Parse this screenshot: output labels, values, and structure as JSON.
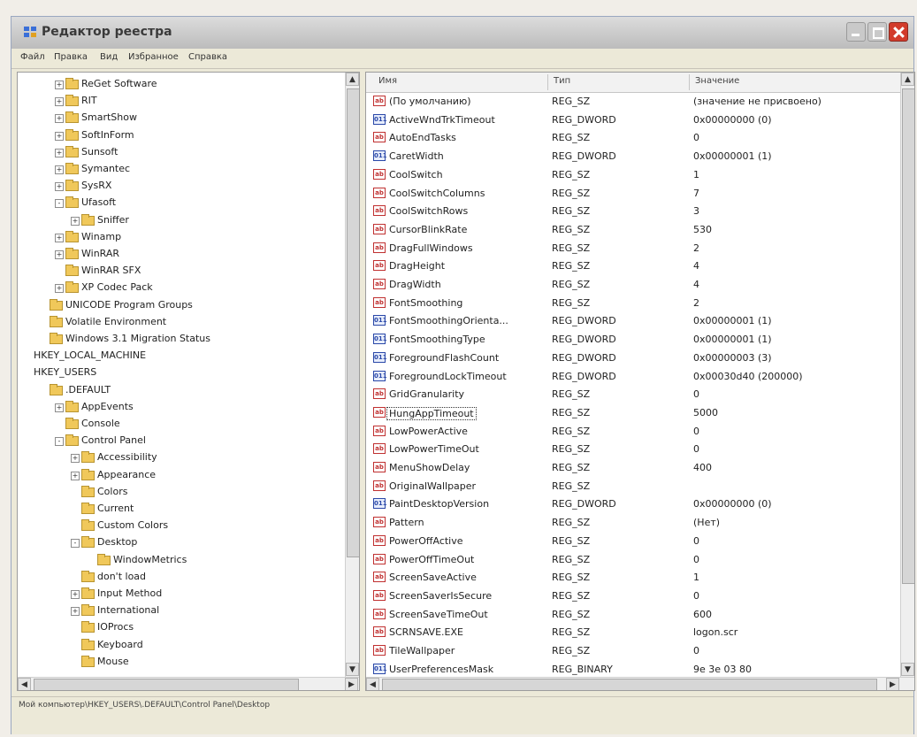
{
  "window": {
    "title": "Редактор реестра"
  },
  "menu": [
    "Файл",
    "Правка",
    "Вид",
    "Избранное",
    "Справка"
  ],
  "tree": [
    {
      "label": "ReGet Software",
      "level": 0,
      "expand": "+"
    },
    {
      "label": "RIT",
      "level": 0,
      "expand": "+"
    },
    {
      "label": "SmartShow",
      "level": 0,
      "expand": "+"
    },
    {
      "label": "SoftInForm",
      "level": 0,
      "expand": "+"
    },
    {
      "label": "Sunsoft",
      "level": 0,
      "expand": "+"
    },
    {
      "label": "Symantec",
      "level": 0,
      "expand": "+"
    },
    {
      "label": "SysRX",
      "level": 0,
      "expand": "+"
    },
    {
      "label": "Ufasoft",
      "level": 0,
      "expand": "-"
    },
    {
      "label": "Sniffer",
      "level": 1,
      "expand": "+"
    },
    {
      "label": "Winamp",
      "level": 0,
      "expand": "+"
    },
    {
      "label": "WinRAR",
      "level": 0,
      "expand": "+"
    },
    {
      "label": "WinRAR SFX",
      "level": 0,
      "expand": ""
    },
    {
      "label": "XP Codec Pack",
      "level": 0,
      "expand": "+"
    },
    {
      "label": "UNICODE Program Groups",
      "level": -1,
      "expand": ""
    },
    {
      "label": "Volatile Environment",
      "level": -1,
      "expand": ""
    },
    {
      "label": "Windows 3.1 Migration Status",
      "level": -1,
      "expand": ""
    },
    {
      "label": "HKEY_LOCAL_MACHINE",
      "level": -2,
      "expand": ""
    },
    {
      "label": "HKEY_USERS",
      "level": -2,
      "expand": ""
    },
    {
      "label": ".DEFAULT",
      "level": -1,
      "expand": ""
    },
    {
      "label": "AppEvents",
      "level": 0,
      "expand": "+"
    },
    {
      "label": "Console",
      "level": 0,
      "expand": ""
    },
    {
      "label": "Control Panel",
      "level": 0,
      "expand": "-"
    },
    {
      "label": "Accessibility",
      "level": 1,
      "expand": "+"
    },
    {
      "label": "Appearance",
      "level": 1,
      "expand": "+"
    },
    {
      "label": "Colors",
      "level": 1,
      "expand": ""
    },
    {
      "label": "Current",
      "level": 1,
      "expand": ""
    },
    {
      "label": "Custom Colors",
      "level": 1,
      "expand": ""
    },
    {
      "label": "Desktop",
      "level": 1,
      "expand": "-"
    },
    {
      "label": "WindowMetrics",
      "level": 2,
      "expand": ""
    },
    {
      "label": "don't load",
      "level": 1,
      "expand": ""
    },
    {
      "label": "Input Method",
      "level": 1,
      "expand": "+"
    },
    {
      "label": "International",
      "level": 1,
      "expand": "+"
    },
    {
      "label": "IOProcs",
      "level": 1,
      "expand": ""
    },
    {
      "label": "Keyboard",
      "level": 1,
      "expand": ""
    },
    {
      "label": "Mouse",
      "level": 1,
      "expand": ""
    }
  ],
  "list": {
    "headers": [
      "Имя",
      "Тип",
      "Значение"
    ],
    "rows": [
      {
        "name": "(По умолчанию)",
        "type": "REG_SZ",
        "value": "(значение не присвоено)",
        "icon": "ab"
      },
      {
        "name": "ActiveWndTrkTimeout",
        "type": "REG_DWORD",
        "value": "0x00000000 (0)",
        "icon": "bin"
      },
      {
        "name": "AutoEndTasks",
        "type": "REG_SZ",
        "value": "0",
        "icon": "ab"
      },
      {
        "name": "CaretWidth",
        "type": "REG_DWORD",
        "value": "0x00000001 (1)",
        "icon": "bin"
      },
      {
        "name": "CoolSwitch",
        "type": "REG_SZ",
        "value": "1",
        "icon": "ab"
      },
      {
        "name": "CoolSwitchColumns",
        "type": "REG_SZ",
        "value": "7",
        "icon": "ab"
      },
      {
        "name": "CoolSwitchRows",
        "type": "REG_SZ",
        "value": "3",
        "icon": "ab"
      },
      {
        "name": "CursorBlinkRate",
        "type": "REG_SZ",
        "value": "530",
        "icon": "ab"
      },
      {
        "name": "DragFullWindows",
        "type": "REG_SZ",
        "value": "2",
        "icon": "ab"
      },
      {
        "name": "DragHeight",
        "type": "REG_SZ",
        "value": "4",
        "icon": "ab"
      },
      {
        "name": "DragWidth",
        "type": "REG_SZ",
        "value": "4",
        "icon": "ab"
      },
      {
        "name": "FontSmoothing",
        "type": "REG_SZ",
        "value": "2",
        "icon": "ab"
      },
      {
        "name": "FontSmoothingOrienta...",
        "type": "REG_DWORD",
        "value": "0x00000001 (1)",
        "icon": "bin"
      },
      {
        "name": "FontSmoothingType",
        "type": "REG_DWORD",
        "value": "0x00000001 (1)",
        "icon": "bin"
      },
      {
        "name": "ForegroundFlashCount",
        "type": "REG_DWORD",
        "value": "0x00000003 (3)",
        "icon": "bin"
      },
      {
        "name": "ForegroundLockTimeout",
        "type": "REG_DWORD",
        "value": "0x00030d40 (200000)",
        "icon": "bin"
      },
      {
        "name": "GridGranularity",
        "type": "REG_SZ",
        "value": "0",
        "icon": "ab"
      },
      {
        "name": "HungAppTimeout",
        "type": "REG_SZ",
        "value": "5000",
        "icon": "ab",
        "selected": true
      },
      {
        "name": "LowPowerActive",
        "type": "REG_SZ",
        "value": "0",
        "icon": "ab"
      },
      {
        "name": "LowPowerTimeOut",
        "type": "REG_SZ",
        "value": "0",
        "icon": "ab"
      },
      {
        "name": "MenuShowDelay",
        "type": "REG_SZ",
        "value": "400",
        "icon": "ab"
      },
      {
        "name": "OriginalWallpaper",
        "type": "REG_SZ",
        "value": "",
        "icon": "ab"
      },
      {
        "name": "PaintDesktopVersion",
        "type": "REG_DWORD",
        "value": "0x00000000 (0)",
        "icon": "bin"
      },
      {
        "name": "Pattern",
        "type": "REG_SZ",
        "value": "(Нет)",
        "icon": "ab"
      },
      {
        "name": "PowerOffActive",
        "type": "REG_SZ",
        "value": "0",
        "icon": "ab"
      },
      {
        "name": "PowerOffTimeOut",
        "type": "REG_SZ",
        "value": "0",
        "icon": "ab"
      },
      {
        "name": "ScreenSaveActive",
        "type": "REG_SZ",
        "value": "1",
        "icon": "ab"
      },
      {
        "name": "ScreenSaverIsSecure",
        "type": "REG_SZ",
        "value": "0",
        "icon": "ab"
      },
      {
        "name": "ScreenSaveTimeOut",
        "type": "REG_SZ",
        "value": "600",
        "icon": "ab"
      },
      {
        "name": "SCRNSAVE.EXE",
        "type": "REG_SZ",
        "value": "logon.scr",
        "icon": "ab"
      },
      {
        "name": "TileWallpaper",
        "type": "REG_SZ",
        "value": "0",
        "icon": "ab"
      },
      {
        "name": "UserPreferencesMask",
        "type": "REG_BINARY",
        "value": "9e 3e 03 80",
        "icon": "bin"
      }
    ]
  },
  "status": "Мой компьютер\\HKEY_USERS\\.DEFAULT\\Control Panel\\Desktop",
  "colors": {
    "accent": "#d23b2b",
    "window_bg": "#ece9d8"
  }
}
